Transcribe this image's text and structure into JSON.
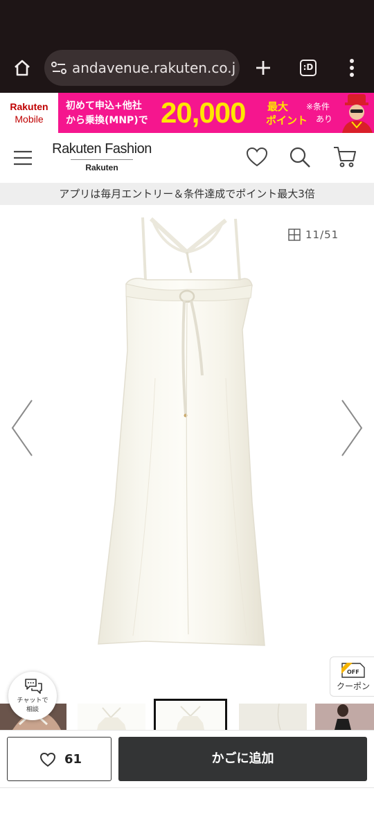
{
  "browser": {
    "url": "andavenue.rakuten.co.jp",
    "extension_label": ":D"
  },
  "banner": {
    "logo_line1": "Rakuten",
    "logo_line2": "Mobile",
    "line1": "初めて申込+他社",
    "line2": "から乗換(MNP)で",
    "amount": "20,000",
    "max_label": "最大",
    "point_label": "ポイント",
    "cond_line1": "※条件",
    "cond_line2": "あり",
    "colors": {
      "background": "#f5168e",
      "highlight": "#ffe600"
    }
  },
  "header": {
    "brand_name": "Rakuten Fashion",
    "brand_sub": "Rakuten"
  },
  "notice": {
    "text": "アプリは毎月エントリー＆条件達成でポイント最大3倍"
  },
  "gallery": {
    "counter": "11/51"
  },
  "coupon": {
    "tag_text": "OFF",
    "label": "クーポン"
  },
  "chat": {
    "line1": "チャットで",
    "line2": "相談"
  },
  "actions": {
    "favorite_count": "61",
    "add_to_cart_label": "かごに追加"
  }
}
